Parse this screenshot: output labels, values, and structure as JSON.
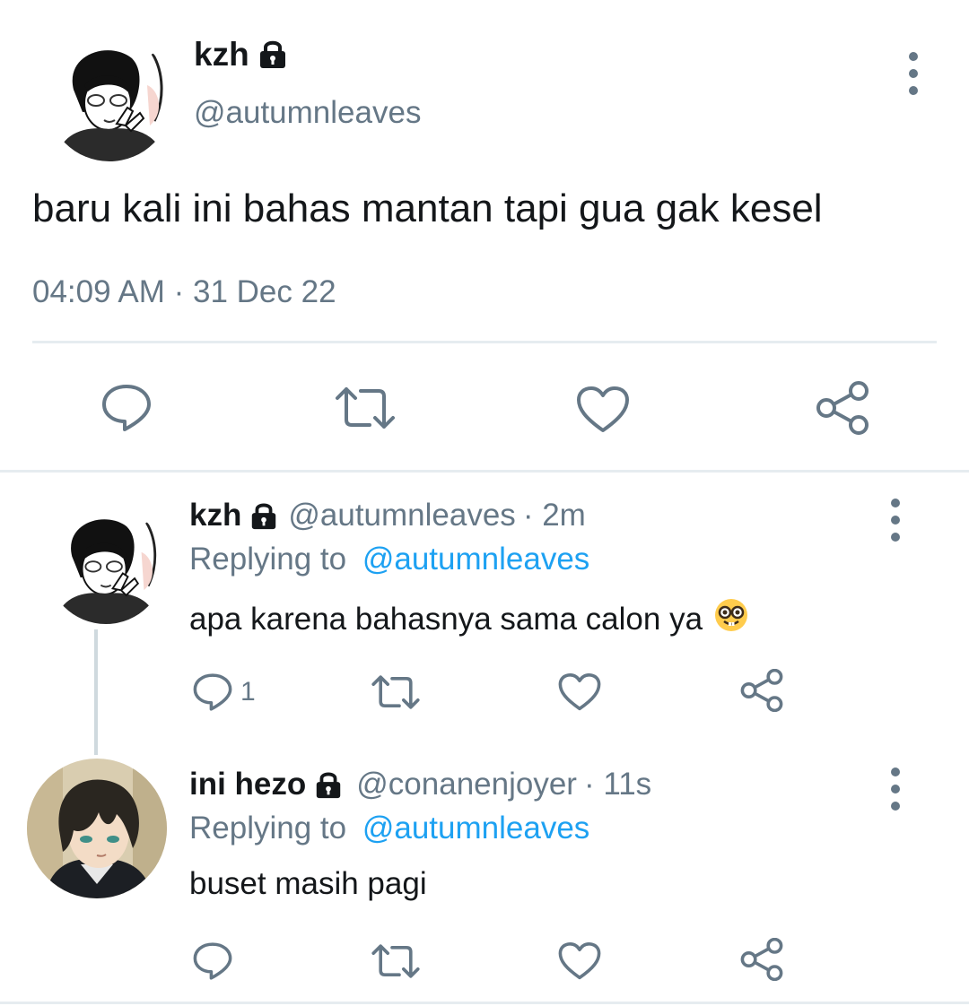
{
  "main_tweet": {
    "display_name": "kzh",
    "handle": "@autumnleaves",
    "text": "baru kali ini bahas mantan tapi gua gak kesel",
    "timestamp": "04:09 AM · 31 Dec 22",
    "protected_icon": "lock-icon",
    "actions": [
      "reply-icon",
      "retweet-icon",
      "like-icon",
      "share-icon"
    ]
  },
  "replies": [
    {
      "display_name": "kzh",
      "handle": "@autumnleaves",
      "time": "· 2m",
      "replying_label": "Replying to",
      "replying_to": "@autumnleaves",
      "text": "apa karena bahasnya sama calon ya",
      "emoji": "🤓",
      "reply_count": "1"
    },
    {
      "display_name": "ini hezo",
      "handle": "@conanenjoyer",
      "time": "· 11s",
      "replying_label": "Replying to",
      "replying_to": "@autumnleaves",
      "text": "buset masih pagi",
      "reply_count": ""
    }
  ],
  "colors": {
    "text": "#14171a",
    "muted": "#657786",
    "link": "#1da1f2",
    "divider": "#e6ecf0"
  }
}
